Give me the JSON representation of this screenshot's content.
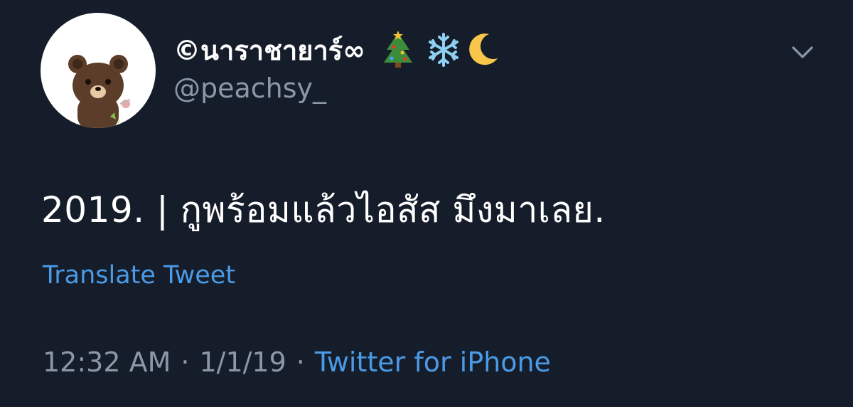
{
  "user": {
    "display_name": "©นาราชายาร์∞",
    "name_emojis": [
      "christmas-tree-icon",
      "snowflake-icon",
      "crescent-moon-icon"
    ],
    "handle": "@peachsy_",
    "avatar": "brown-bear-avatar"
  },
  "tweet": {
    "text": "2019. | กูพร้อมแล้วไอสัส มึงมาเลย.",
    "translate_label": "Translate Tweet",
    "time": "12:32 AM",
    "date": "1/1/19",
    "separator": "·",
    "source": "Twitter for iPhone"
  },
  "menu": {
    "icon": "chevron-down-icon"
  },
  "colors": {
    "background": "#161d2a",
    "text": "#ffffff",
    "muted": "#8a98a8",
    "link": "#4a9ae6"
  }
}
